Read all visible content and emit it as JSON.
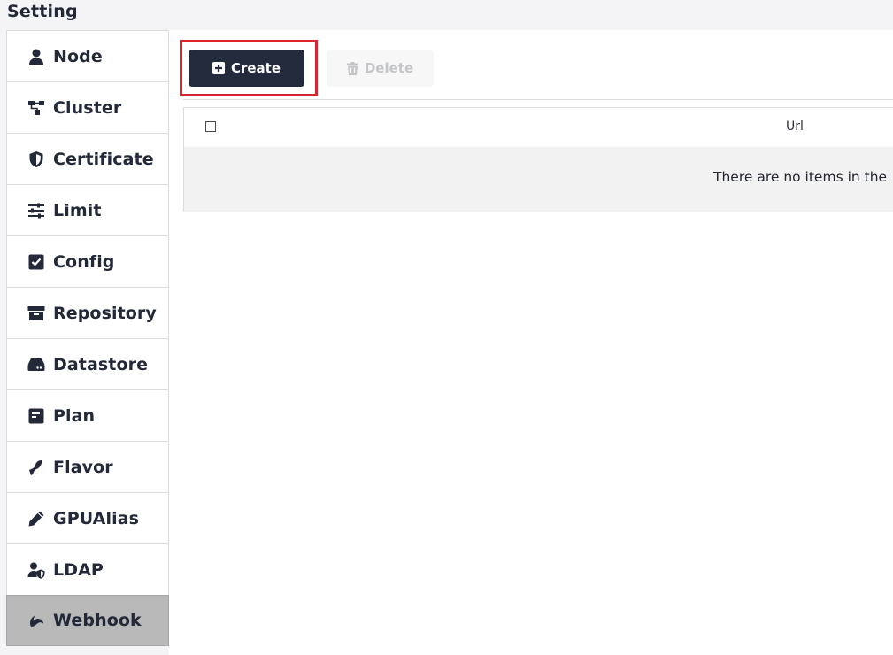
{
  "page": {
    "title": "Setting"
  },
  "sidebar": {
    "items": [
      {
        "label": "Node",
        "icon": "user-icon"
      },
      {
        "label": "Cluster",
        "icon": "sitemap-icon"
      },
      {
        "label": "Certificate",
        "icon": "shield-icon"
      },
      {
        "label": "Limit",
        "icon": "sliders-icon"
      },
      {
        "label": "Config",
        "icon": "checkbox-icon"
      },
      {
        "label": "Repository",
        "icon": "archive-icon"
      },
      {
        "label": "Datastore",
        "icon": "hard-drive-icon"
      },
      {
        "label": "Plan",
        "icon": "list-card-icon"
      },
      {
        "label": "Flavor",
        "icon": "flavor-icon"
      },
      {
        "label": "GPUAlias",
        "icon": "pencil-icon"
      },
      {
        "label": "LDAP",
        "icon": "user-shield-icon"
      },
      {
        "label": "Webhook",
        "icon": "webhook-icon",
        "active": true
      }
    ]
  },
  "toolbar": {
    "create_label": "Create",
    "create_icon": "plus-square-icon",
    "delete_label": "Delete",
    "delete_icon": "trash-icon",
    "highlight_color": "#d7262f"
  },
  "table": {
    "columns": [
      "Url"
    ],
    "empty_message": "There are no items in the"
  },
  "colors": {
    "primary_button": "#222a3b",
    "active_sidebar": "#b9b9b9",
    "highlight": "#d7262f"
  }
}
